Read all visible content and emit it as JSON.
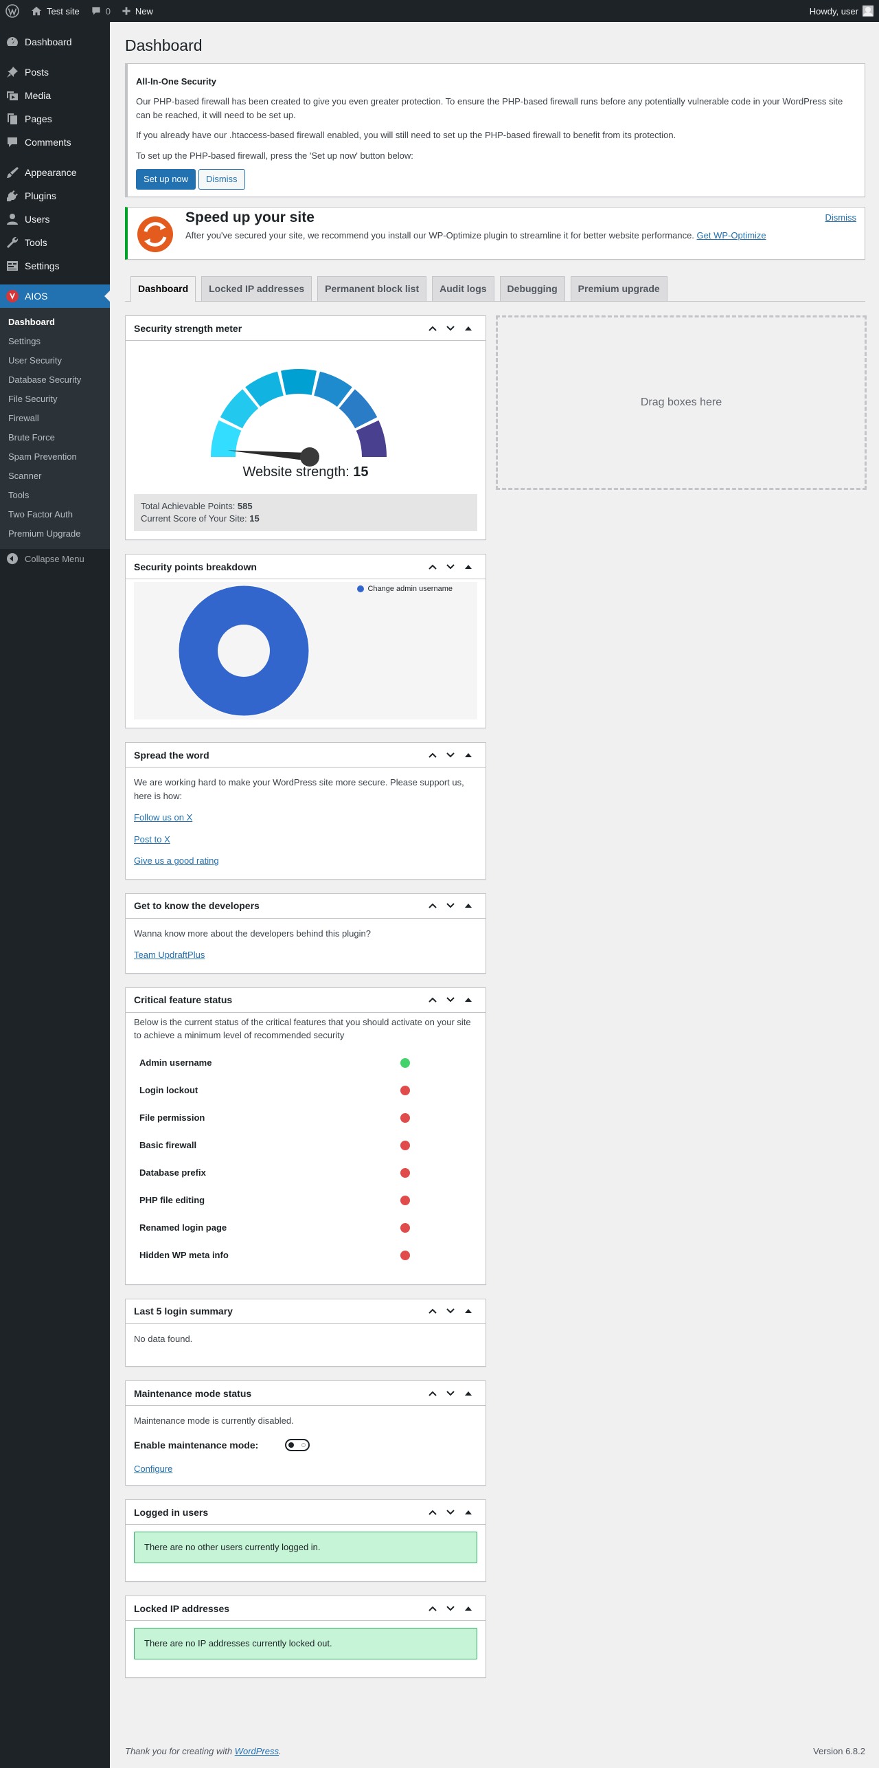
{
  "adminbar": {
    "site_name": "Test site",
    "comments_count": "0",
    "new_label": "New",
    "howdy": "Howdy, user"
  },
  "sidebar": {
    "items": [
      {
        "label": "Dashboard",
        "icon": "dashboard-icon"
      },
      {
        "label": "Posts",
        "icon": "pin-icon"
      },
      {
        "label": "Media",
        "icon": "media-icon"
      },
      {
        "label": "Pages",
        "icon": "pages-icon"
      },
      {
        "label": "Comments",
        "icon": "comments-icon"
      },
      {
        "label": "Appearance",
        "icon": "brush-icon"
      },
      {
        "label": "Plugins",
        "icon": "plugin-icon"
      },
      {
        "label": "Users",
        "icon": "users-icon"
      },
      {
        "label": "Tools",
        "icon": "wrench-icon"
      },
      {
        "label": "Settings",
        "icon": "settings-icon"
      },
      {
        "label": "AIOS",
        "icon": "aios-shield-icon"
      }
    ],
    "submenu": [
      "Dashboard",
      "Settings",
      "User Security",
      "Database Security",
      "File Security",
      "Firewall",
      "Brute Force",
      "Spam Prevention",
      "Scanner",
      "Tools",
      "Two Factor Auth",
      "Premium Upgrade"
    ],
    "collapse": "Collapse Menu"
  },
  "page": {
    "title": "Dashboard"
  },
  "notice_firewall": {
    "title": "All-In-One Security",
    "p1": "Our PHP-based firewall has been created to give you even greater protection. To ensure the PHP-based firewall runs before any potentially vulnerable code in your WordPress site can be reached, it will need to be set up.",
    "p2": "If you already have our .htaccess-based firewall enabled, you will still need to set up the PHP-based firewall to benefit from its protection.",
    "p3": "To set up the PHP-based firewall, press the 'Set up now' button below:",
    "setup_btn": "Set up now",
    "dismiss_btn": "Dismiss"
  },
  "notice_speed": {
    "title": "Speed up your site",
    "text": "After you've secured your site, we recommend you install our WP-Optimize plugin to streamline it for better website performance.",
    "link": "Get WP-Optimize",
    "dismiss": "Dismiss"
  },
  "tabs": [
    "Dashboard",
    "Locked IP addresses",
    "Permanent block list",
    "Audit logs",
    "Debugging",
    "Premium upgrade"
  ],
  "meter": {
    "title": "Security strength meter",
    "strength_label": "Website strength: ",
    "strength_value": "15",
    "value": 15,
    "max": 585,
    "total_label": "Total Achievable Points: ",
    "total_value": "585",
    "current_label": "Current Score of Your Site: ",
    "current_value": "15",
    "segment_colors": [
      "#33ddff",
      "#22c8ee",
      "#11b4e0",
      "#00a0d2",
      "#1e8bcf",
      "#2a7cc7",
      "#4a4090"
    ]
  },
  "breakdown": {
    "title": "Security points breakdown",
    "legend": "Change admin username",
    "color": "#3366cc"
  },
  "chart_data": {
    "type": "pie",
    "categories": [
      "Change admin username"
    ],
    "values": [
      15
    ],
    "title": "",
    "legend_position": "top-right"
  },
  "spread": {
    "title": "Spread the word",
    "text": "We are working hard to make your WordPress site more secure. Please support us, here is how:",
    "links": [
      "Follow us on X",
      "Post to X",
      "Give us a good rating"
    ]
  },
  "developers": {
    "title": "Get to know the developers",
    "text": "Wanna know more about the developers behind this plugin?",
    "link": "Team UpdraftPlus"
  },
  "critical": {
    "title": "Critical feature status",
    "text": "Below is the current status of the critical features that you should activate on your site to achieve a minimum level of recommended security",
    "features": [
      {
        "name": "Admin username",
        "status": "on",
        "color": "#44d36a"
      },
      {
        "name": "Login lockout",
        "status": "off",
        "color": "#e04b4b"
      },
      {
        "name": "File permission",
        "status": "off",
        "color": "#e04b4b"
      },
      {
        "name": "Basic firewall",
        "status": "off",
        "color": "#e04b4b"
      },
      {
        "name": "Database prefix",
        "status": "off",
        "color": "#e04b4b"
      },
      {
        "name": "PHP file editing",
        "status": "off",
        "color": "#e04b4b"
      },
      {
        "name": "Renamed login page",
        "status": "off",
        "color": "#e04b4b"
      },
      {
        "name": "Hidden WP meta info",
        "status": "off",
        "color": "#e04b4b"
      }
    ]
  },
  "logins": {
    "title": "Last 5 login summary",
    "text": "No data found."
  },
  "maintenance": {
    "title": "Maintenance mode status",
    "text": "Maintenance mode is currently disabled.",
    "toggle_label": "Enable maintenance mode:",
    "enabled": false,
    "link": "Configure"
  },
  "logged_in": {
    "title": "Logged in users",
    "text": "There are no other users currently logged in."
  },
  "locked_ips": {
    "title": "Locked IP addresses",
    "text": "There are no IP addresses currently locked out."
  },
  "dropzone": {
    "text": "Drag boxes here"
  },
  "footer": {
    "thanks_prefix": "Thank you for creating with ",
    "thanks_link": "WordPress",
    "thanks_suffix": ".",
    "version": "Version 6.8.2"
  }
}
